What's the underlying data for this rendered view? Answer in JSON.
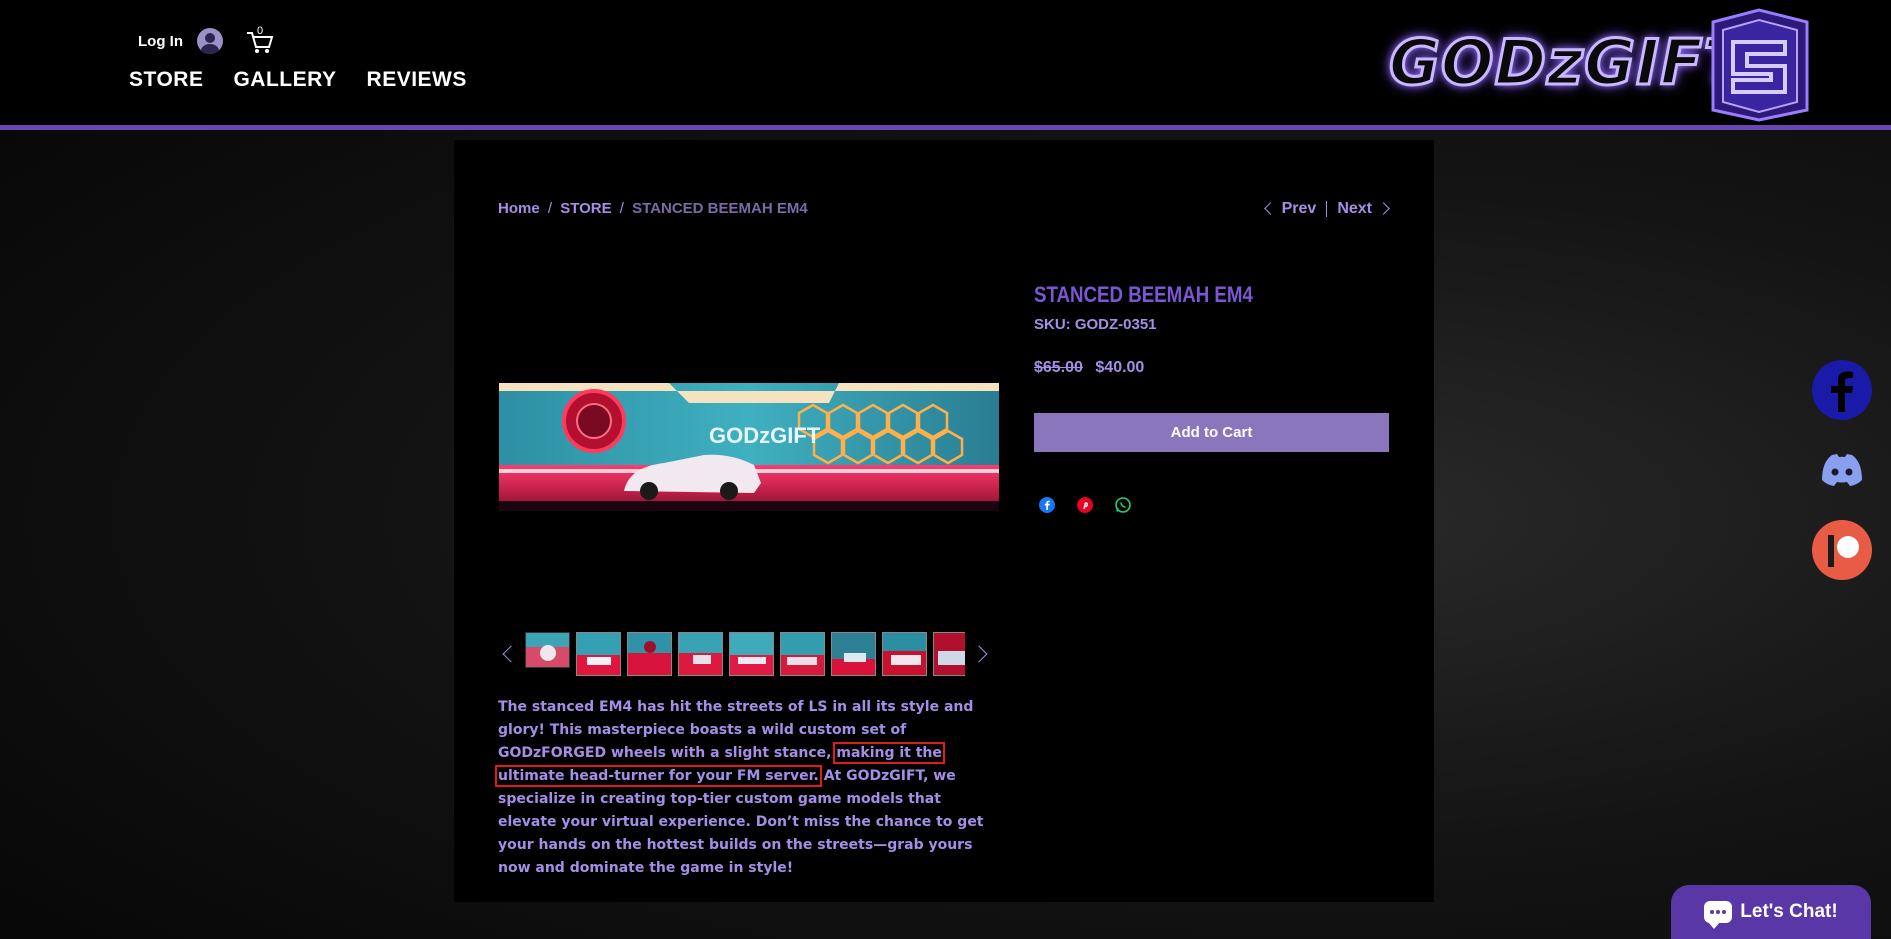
{
  "header": {
    "login_label": "Log In",
    "cart_count": "0",
    "nav": [
      "STORE",
      "GALLERY",
      "REVIEWS"
    ],
    "logo_text": "GODzGIFT"
  },
  "breadcrumb": {
    "home": "Home",
    "store": "STORE",
    "current": "STANCED BEEMAH EM4",
    "separator": "/"
  },
  "pager": {
    "prev": "Prev",
    "next": "Next"
  },
  "product": {
    "title": "STANCED BEEMAH EM4",
    "sku": "SKU: GODZ-0351",
    "price_old": "$65.00",
    "price_new": "$40.00",
    "add_to_cart": "Add to Cart",
    "image_text": "GODzGIFT"
  },
  "description": {
    "part1": "The stanced EM4 has hit the streets of LS in all its style and glory! This masterpiece boasts a wild custom set of GODzFORGED wheels with a slight stance, ",
    "highlight": "making it the ultimate head-turner for your FM server.",
    "part2": " At GODzGIFT, we specialize in creating top-tier custom game models that elevate your virtual experience. Don’t miss the chance to get your hands on the hottest builds on the streets—grab yours now and dominate the game in style!"
  },
  "chat": {
    "label": "Let's Chat!"
  },
  "colors": {
    "accent": "#7b57d6",
    "text_purple": "#a48ee6",
    "button": "#8a76bd",
    "header_border": "#6a47b5"
  }
}
